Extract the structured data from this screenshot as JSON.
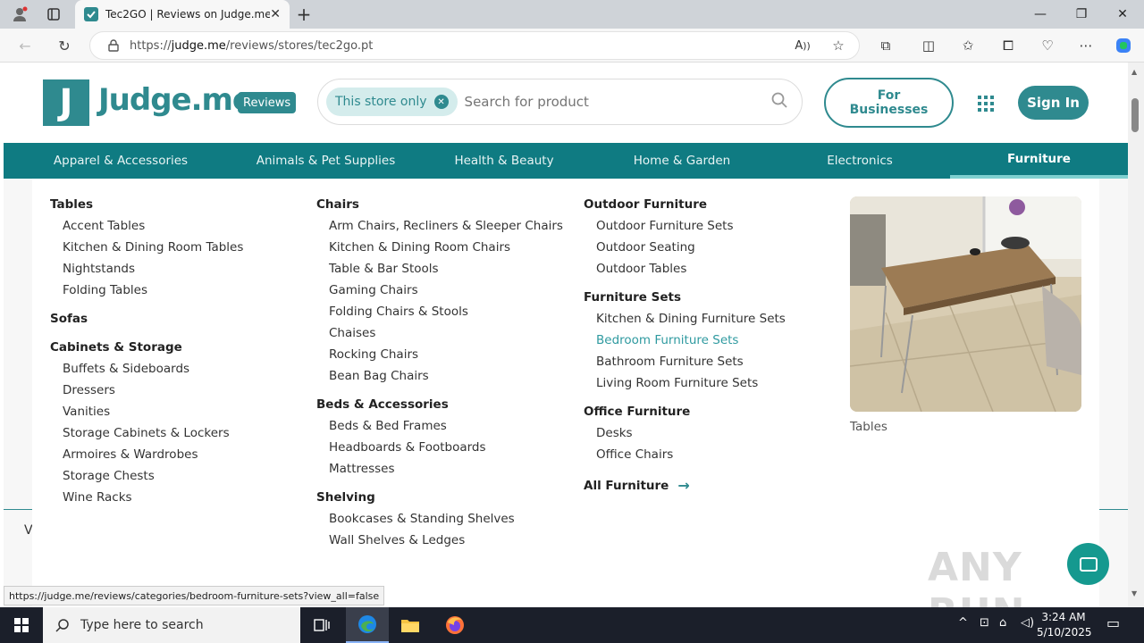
{
  "browser": {
    "tab_title": "Tec2GO | Reviews on Judge.me",
    "url_prefix": "https://",
    "url_domain": "judge.me",
    "url_path": "/reviews/stores/tec2go.pt",
    "status_url": "https://judge.me/reviews/categories/bedroom-furniture-sets?view_all=false"
  },
  "header": {
    "logo_letter": "J",
    "logo_text": "Judge.me",
    "logo_badge": "Reviews",
    "search_chip": "This store only",
    "search_placeholder": "Search for product",
    "biz_line1": "For",
    "biz_line2": "Businesses",
    "signin": "Sign In"
  },
  "categories": [
    {
      "label": "Apparel & Accessories",
      "active": false
    },
    {
      "label": "Animals & Pet Supplies",
      "active": false
    },
    {
      "label": "Health & Beauty",
      "active": false
    },
    {
      "label": "Home & Garden",
      "active": false
    },
    {
      "label": "Electronics",
      "active": false
    },
    {
      "label": "Furniture",
      "active": true
    }
  ],
  "dropdown": {
    "col1": {
      "g1": {
        "title": "Tables",
        "items": [
          "Accent Tables",
          "Kitchen & Dining Room Tables",
          "Nightstands",
          "Folding Tables"
        ]
      },
      "g2": {
        "title": "Sofas"
      },
      "g3": {
        "title": "Cabinets & Storage",
        "items": [
          "Buffets & Sideboards",
          "Dressers",
          "Vanities",
          "Storage Cabinets & Lockers",
          "Armoires & Wardrobes",
          "Storage Chests",
          "Wine Racks"
        ]
      }
    },
    "col2": {
      "g1": {
        "title": "Chairs",
        "items": [
          "Arm Chairs, Recliners & Sleeper Chairs",
          "Kitchen & Dining Room Chairs",
          "Table & Bar Stools",
          "Gaming Chairs",
          "Folding Chairs & Stools",
          "Chaises",
          "Rocking Chairs",
          "Bean Bag Chairs"
        ]
      },
      "g2": {
        "title": "Beds & Accessories",
        "items": [
          "Beds & Bed Frames",
          "Headboards & Footboards",
          "Mattresses"
        ]
      },
      "g3": {
        "title": "Shelving",
        "items": [
          "Bookcases & Standing Shelves",
          "Wall Shelves & Ledges"
        ]
      }
    },
    "col3": {
      "g1": {
        "title": "Outdoor Furniture",
        "items": [
          "Outdoor Furniture Sets",
          "Outdoor Seating",
          "Outdoor Tables"
        ]
      },
      "g2": {
        "title": "Furniture Sets",
        "items": [
          "Kitchen & Dining Furniture Sets",
          "Bedroom Furniture Sets",
          "Bathroom Furniture Sets",
          "Living Room Furniture Sets"
        ]
      },
      "g3": {
        "title": "Office Furniture",
        "items": [
          "Desks",
          "Office Chairs"
        ]
      },
      "all": "All Furniture"
    },
    "photo_caption": "Tables"
  },
  "page_edge_letter": "V",
  "watermark": "ANY RUN",
  "taskbar": {
    "search_text": "Type here to search",
    "time": "3:24 AM",
    "date": "5/10/2025"
  }
}
